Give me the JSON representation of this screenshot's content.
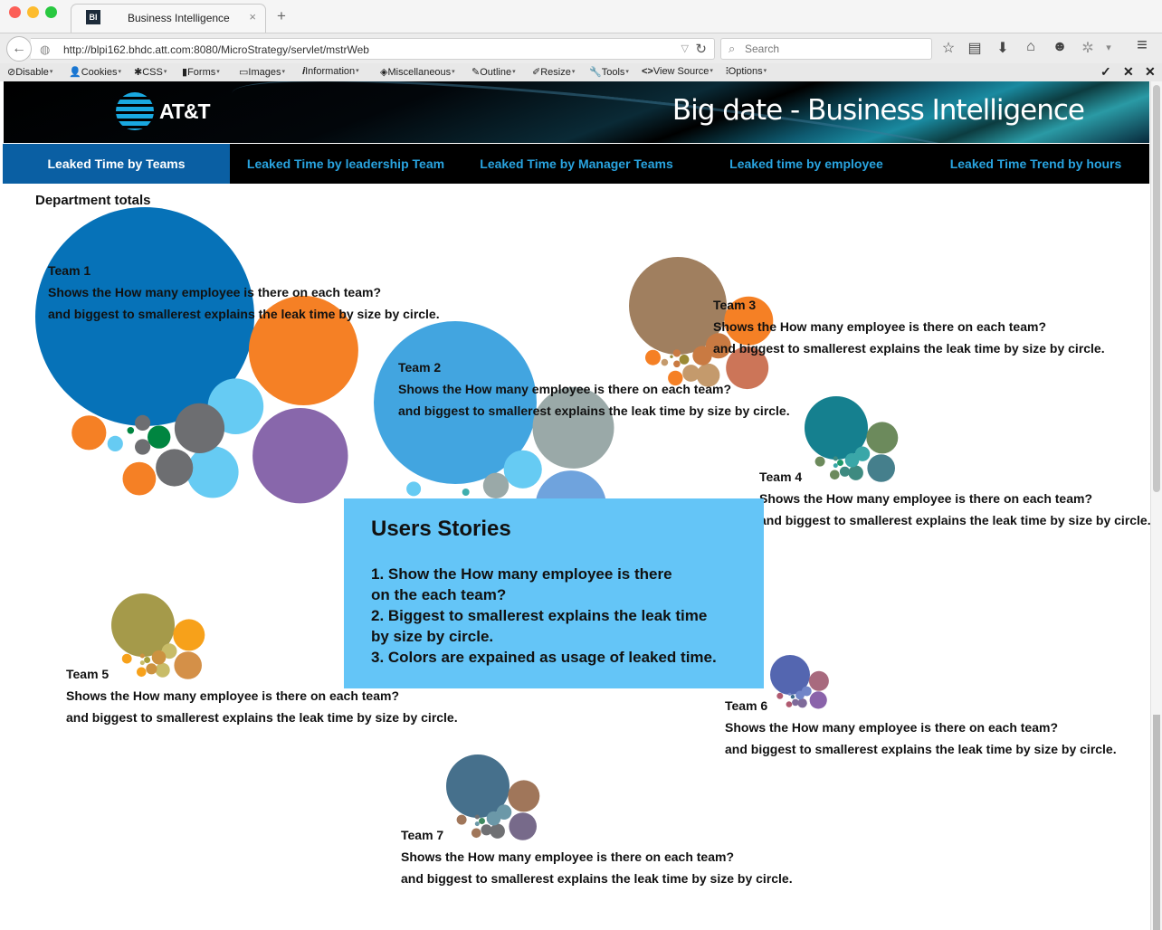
{
  "browser": {
    "tab_favicon": "BI",
    "tab_title": "Business Intelligence",
    "tab_close": "×",
    "new_tab": "+",
    "back_icon": "←",
    "globe_icon": "◍",
    "url": "http://blpi162.bhdc.att.com:8080/MicroStrategy/servlet/mstrWeb",
    "url_dropdown": "▽",
    "reload_icon": "↻",
    "search_placeholder": "Search",
    "search_icon": "⌕",
    "toolbar_icons": [
      {
        "name": "bookmark-star-icon",
        "glyph": "☆"
      },
      {
        "name": "reading-list-icon",
        "glyph": "▤"
      },
      {
        "name": "download-icon",
        "glyph": "⬇"
      },
      {
        "name": "home-icon",
        "glyph": "⌂"
      },
      {
        "name": "chat-icon",
        "glyph": "☻"
      },
      {
        "name": "extension-icon",
        "glyph": "✲"
      },
      {
        "name": "extension-dropdown-icon",
        "glyph": "▾"
      },
      {
        "name": "menu-icon",
        "glyph": "≡"
      }
    ]
  },
  "devbar": {
    "items": [
      {
        "icon": "⊘",
        "label": "Disable"
      },
      {
        "icon": "👤",
        "label": "Cookies"
      },
      {
        "icon": "✱",
        "label": "CSS"
      },
      {
        "icon": "▮",
        "label": "Forms"
      },
      {
        "icon": "▭",
        "label": "Images"
      },
      {
        "icon": "𝒊",
        "label": "Information"
      },
      {
        "icon": "◈",
        "label": "Miscellaneous"
      },
      {
        "icon": "✎",
        "label": "Outline"
      },
      {
        "icon": "✐",
        "label": "Resize"
      },
      {
        "icon": "🔧",
        "label": "Tools"
      },
      {
        "icon": "<>",
        "label": "View Source"
      },
      {
        "icon": "⫶",
        "label": "Options"
      }
    ],
    "caret": "▾",
    "right_icons": [
      {
        "name": "check-icon",
        "glyph": "✓"
      },
      {
        "name": "close-icon",
        "glyph": "✕"
      },
      {
        "name": "close-toolbar-icon",
        "glyph": "✕"
      }
    ]
  },
  "header": {
    "logo_text": "AT&T",
    "title": "Big date - Business Intelligence"
  },
  "tabs": [
    {
      "label": "Leaked Time by Teams",
      "active": true
    },
    {
      "label": "Leaked Time by leadership Team",
      "active": false
    },
    {
      "label": "Leaked Time by Manager Teams",
      "active": false
    },
    {
      "label": "Leaked time by employee",
      "active": false
    },
    {
      "label": "Leaked Time Trend by hours",
      "active": false
    }
  ],
  "main": {
    "section_title": "Department totals",
    "teams": [
      {
        "name": "Team 1",
        "line1": "Shows the How many employee is there on each team?",
        "line2": "and biggest to smallerest explains the leak time by size by circle."
      },
      {
        "name": "Team 2",
        "line1": "Shows the How many employee is there on each team?",
        "line2": "and biggest to smallerest explains the leak time by size by circle."
      },
      {
        "name": "Team 3",
        "line1": "Shows the How many employee is there on each team?",
        "line2": "and biggest to smallerest explains the leak time by size by circle."
      },
      {
        "name": "Team 4",
        "line1": "Shows the How many employee is there on each team?",
        "line2": "and biggest to smallerest explains the leak time by size by circle."
      },
      {
        "name": "Team 5",
        "line1": "Shows the How many employee is there on each team?",
        "line2": "and biggest to smallerest explains the leak time by size by circle."
      },
      {
        "name": "Team 6",
        "line1": "Shows the How many employee is there on each team?",
        "line2": "and biggest to smallerest explains the leak time by size by circle."
      },
      {
        "name": "Team 7",
        "line1": "Shows the How many employee is there on each team?",
        "line2": "and biggest to smallerest explains the leak time by size by circle."
      }
    ],
    "stories": {
      "title": "Users Stories",
      "lines": [
        "1. Show the How many employee is there",
        "on the each team?",
        "2. Biggest to smallerest explains the leak time",
        "by size by circle.",
        "3. Colors are expained as usage of leaked time."
      ]
    }
  },
  "chart_data": {
    "type": "bubble",
    "title": "Department totals",
    "note": "Packed bubble clusters; each bubble is one employee, size = relative leaked time (estimated relative units), colors indicate usage category.",
    "series": [
      {
        "name": "Team 1",
        "bubbles": [
          {
            "value": 100,
            "color": "#0672b8"
          },
          {
            "value": 25,
            "color": "#f58025"
          },
          {
            "value": 19,
            "color": "#8867ab"
          },
          {
            "value": 6.5,
            "color": "#66cbf3"
          },
          {
            "value": 5.6,
            "color": "#66cbf3"
          },
          {
            "value": 5.2,
            "color": "#6d6e71"
          },
          {
            "value": 2.9,
            "color": "#6d6e71"
          },
          {
            "value": 2.5,
            "color": "#f58025"
          },
          {
            "value": 2.3,
            "color": "#f58025"
          },
          {
            "value": 1.1,
            "color": "#008540"
          },
          {
            "value": 0.5,
            "color": "#6d6e71"
          },
          {
            "value": 0.5,
            "color": "#6d6e71"
          },
          {
            "value": 0.5,
            "color": "#66cbf3"
          },
          {
            "value": 0.1,
            "color": "#008540"
          }
        ]
      },
      {
        "name": "Team 2",
        "bubbles": [
          {
            "value": 100,
            "color": "#42a5e0"
          },
          {
            "value": 25,
            "color": "#9aa9a8"
          },
          {
            "value": 19,
            "color": "#6fa3dd"
          },
          {
            "value": 5.5,
            "color": "#66cbf3"
          },
          {
            "value": 5.2,
            "color": "#5ea3c8"
          },
          {
            "value": 2.5,
            "color": "#9aa9a8"
          },
          {
            "value": 1.4,
            "color": "#3eaeae"
          },
          {
            "value": 0.8,
            "color": "#66cbf3"
          },
          {
            "value": 0.6,
            "color": "#5ea3c8"
          },
          {
            "value": 0.2,
            "color": "#3eaeae"
          }
        ]
      },
      {
        "name": "Team 3",
        "bubbles": [
          {
            "value": 100,
            "color": "#a07f5f"
          },
          {
            "value": 25,
            "color": "#f58025"
          },
          {
            "value": 19,
            "color": "#cc7558"
          },
          {
            "value": 6.7,
            "color": "#c97a42"
          },
          {
            "value": 5.7,
            "color": "#c49a6c"
          },
          {
            "value": 3.9,
            "color": "#c97a42"
          },
          {
            "value": 3,
            "color": "#c49a6c"
          },
          {
            "value": 2.5,
            "color": "#f58025"
          },
          {
            "value": 2.3,
            "color": "#f58025"
          },
          {
            "value": 1,
            "color": "#9b8a35"
          },
          {
            "value": 0.6,
            "color": "#c97a42"
          },
          {
            "value": 0.5,
            "color": "#c97a42"
          },
          {
            "value": 0.5,
            "color": "#c49a6c"
          },
          {
            "value": 0.1,
            "color": "#9b8a35"
          }
        ]
      },
      {
        "name": "Team 4",
        "bubbles": [
          {
            "value": 100,
            "color": "#15808f"
          },
          {
            "value": 25,
            "color": "#6c8a5c"
          },
          {
            "value": 19,
            "color": "#457f8c"
          },
          {
            "value": 5.5,
            "color": "#3aa7a8"
          },
          {
            "value": 5.5,
            "color": "#3e8a80"
          },
          {
            "value": 5,
            "color": "#3aa7a8"
          },
          {
            "value": 2.6,
            "color": "#3e8a80"
          },
          {
            "value": 2.5,
            "color": "#6c8a5c"
          },
          {
            "value": 2.3,
            "color": "#6c8a5c"
          },
          {
            "value": 1,
            "color": "#1e9a6a"
          },
          {
            "value": 0.5,
            "color": "#3e8a80"
          },
          {
            "value": 0.5,
            "color": "#3aa7a8"
          }
        ]
      },
      {
        "name": "Team 5",
        "bubbles": [
          {
            "value": 100,
            "color": "#a59a4a"
          },
          {
            "value": 25,
            "color": "#f7a11a"
          },
          {
            "value": 19,
            "color": "#d49048"
          },
          {
            "value": 5.7,
            "color": "#c8bc68"
          },
          {
            "value": 5.2,
            "color": "#c8bc68"
          },
          {
            "value": 5,
            "color": "#cc9240"
          },
          {
            "value": 3,
            "color": "#cc9240"
          },
          {
            "value": 2.4,
            "color": "#f7a11a"
          },
          {
            "value": 2.3,
            "color": "#f7a11a"
          },
          {
            "value": 1,
            "color": "#a8a03a"
          },
          {
            "value": 0.5,
            "color": "#cc9240"
          },
          {
            "value": 0.5,
            "color": "#c8bc68"
          }
        ]
      },
      {
        "name": "Team 6",
        "bubbles": [
          {
            "value": 100,
            "color": "#5466b0"
          },
          {
            "value": 25,
            "color": "#a86a7e"
          },
          {
            "value": 19,
            "color": "#8a63aa"
          },
          {
            "value": 6,
            "color": "#7185c8"
          },
          {
            "value": 5.5,
            "color": "#7e6a9a"
          },
          {
            "value": 5,
            "color": "#7185c8"
          },
          {
            "value": 3,
            "color": "#7e6a9a"
          },
          {
            "value": 2.5,
            "color": "#b05a70"
          },
          {
            "value": 2.3,
            "color": "#b05a70"
          },
          {
            "value": 1,
            "color": "#3a6a8a"
          },
          {
            "value": 0.5,
            "color": "#7185c8"
          }
        ]
      },
      {
        "name": "Team 7",
        "bubbles": [
          {
            "value": 100,
            "color": "#46708c"
          },
          {
            "value": 25,
            "color": "#a0765a"
          },
          {
            "value": 19,
            "color": "#776a8a"
          },
          {
            "value": 5.6,
            "color": "#6b98a8"
          },
          {
            "value": 5.5,
            "color": "#6f7073"
          },
          {
            "value": 5,
            "color": "#6b98a8"
          },
          {
            "value": 3,
            "color": "#6f7073"
          },
          {
            "value": 2.5,
            "color": "#a0765a"
          },
          {
            "value": 2.3,
            "color": "#a0765a"
          },
          {
            "value": 1,
            "color": "#3f8a60"
          },
          {
            "value": 0.5,
            "color": "#6f7073"
          },
          {
            "value": 0.5,
            "color": "#6b98a8"
          }
        ]
      }
    ]
  }
}
